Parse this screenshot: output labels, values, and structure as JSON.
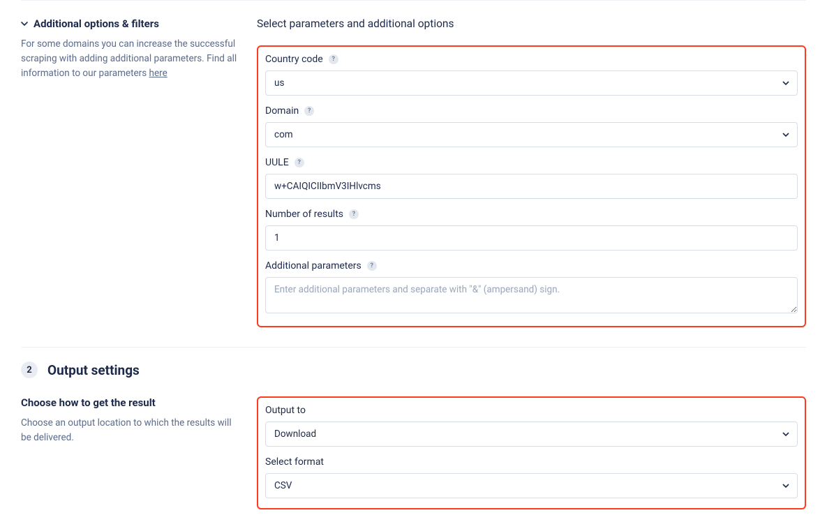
{
  "section1": {
    "collapse_title": "Additional options & filters",
    "desc_pre": "For some domains you can increase the successful scraping with adding additional parameters. Find all information to our parameters ",
    "desc_link": "here",
    "right_title": "Select parameters and additional options",
    "fields": {
      "country": {
        "label": "Country code",
        "value": "us"
      },
      "domain": {
        "label": "Domain",
        "value": "com"
      },
      "uule": {
        "label": "UULE",
        "value": "w+CAIQICIIbmV3IHlvcms"
      },
      "num_results": {
        "label": "Number of results",
        "value": "1"
      },
      "additional": {
        "label": "Additional parameters",
        "placeholder": "Enter additional parameters and separate with \"&\" (ampersand) sign."
      }
    }
  },
  "step2": {
    "badge": "2",
    "title": "Output settings"
  },
  "section2": {
    "left_head": "Choose how to get the result",
    "left_desc": "Choose an output location to which the results will be delivered.",
    "fields": {
      "output_to": {
        "label": "Output to",
        "value": "Download"
      },
      "format": {
        "label": "Select format",
        "value": "CSV"
      }
    }
  }
}
